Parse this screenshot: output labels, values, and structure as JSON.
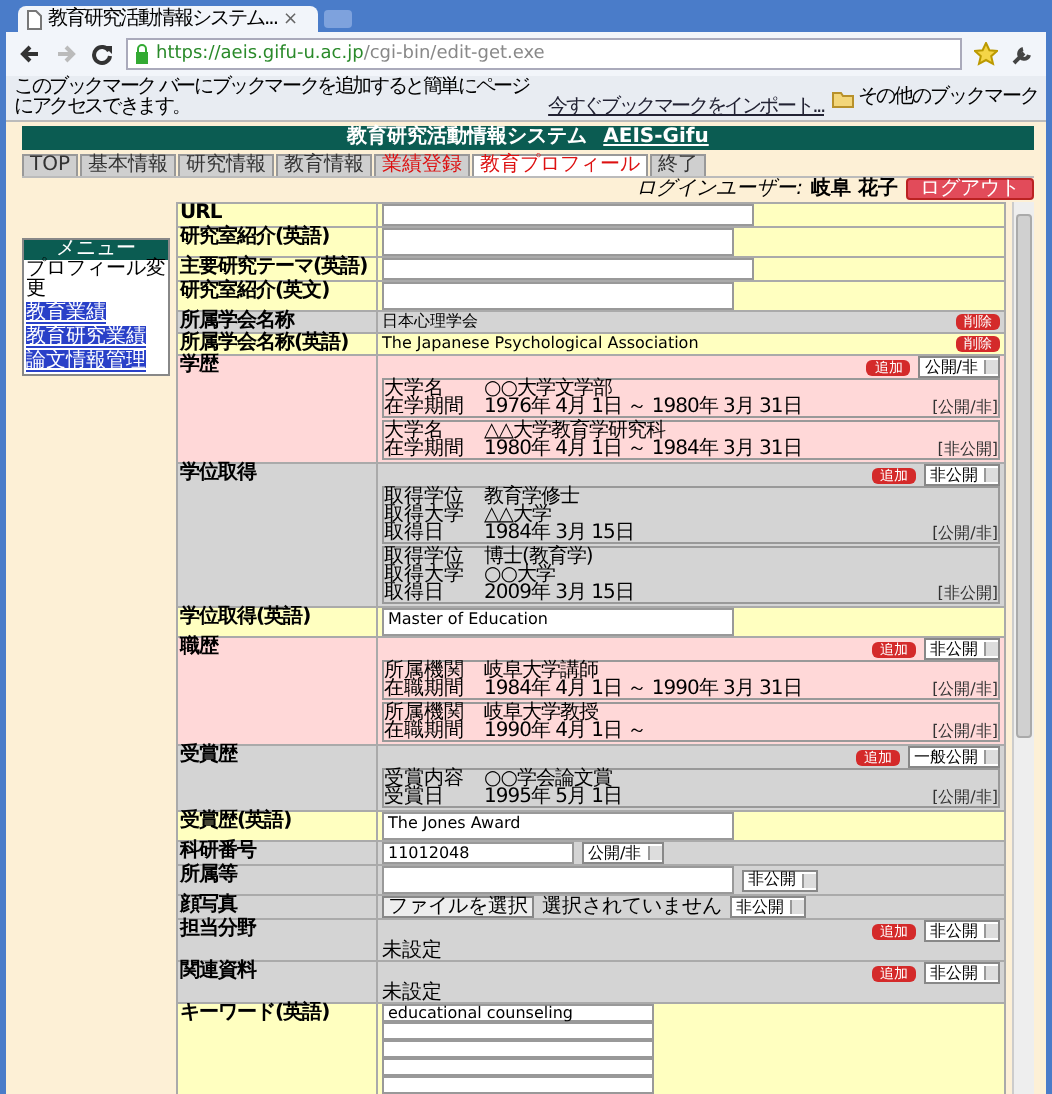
{
  "browser": {
    "tab_title": "教育研究活動情報システム...",
    "tab_close": "×",
    "url_host": "https://aeis.gifu-u.ac.jp",
    "url_path": "/cgi-bin/edit-get.exe",
    "bookmark_hint": "このブックマーク バーにブックマークを追加すると簡単にページにアクセスできます。",
    "bookmark_import": "今すぐブックマークをインポート...",
    "other_bookmarks": "その他のブックマーク"
  },
  "header": {
    "title": "教育研究活動情報システム",
    "link": "AEIS-Gifu"
  },
  "tabs": [
    {
      "label": "TOP",
      "selected": false,
      "emphasized": false
    },
    {
      "label": "基本情報",
      "selected": false,
      "emphasized": false
    },
    {
      "label": "研究情報",
      "selected": false,
      "emphasized": false
    },
    {
      "label": "教育情報",
      "selected": false,
      "emphasized": false
    },
    {
      "label": "業績登録",
      "selected": false,
      "emphasized": true
    },
    {
      "label": "教育プロフィール",
      "selected": true,
      "emphasized": true
    },
    {
      "label": "終了",
      "selected": false,
      "emphasized": false
    }
  ],
  "login": {
    "label": "ログインユーザー:",
    "user": "岐阜 花子",
    "logout": "ログアウト"
  },
  "sidebar": {
    "title": "メニュー",
    "items": [
      {
        "label": "プロフィール変更",
        "kind": "text"
      },
      {
        "label": "教育業績",
        "kind": "link"
      },
      {
        "label": "教育研究業績",
        "kind": "link"
      },
      {
        "label": "論文情報管理",
        "kind": "link"
      }
    ]
  },
  "rows": [
    {
      "kind": "input",
      "label": "URL",
      "color": "#ffffc0"
    },
    {
      "kind": "textarea",
      "label": "研究室紹介(英語)",
      "color": "#ffffc0"
    },
    {
      "kind": "input",
      "label": "主要研究テーマ(英語)",
      "color": "#ffffc0"
    },
    {
      "kind": "textarea",
      "label": "研究室紹介(英文)",
      "color": "#ffffc0"
    },
    {
      "kind": "text",
      "label": "所属学会名称",
      "color": "#d4d4d4",
      "value": "日本心理学会",
      "button": "削除"
    },
    {
      "kind": "text",
      "label": "所属学会名称(英語)",
      "color": "#ffffc0",
      "value": "The Japanese Psychological Association",
      "button": "削除"
    },
    {
      "kind": "list",
      "label": "学歴",
      "color": "#ffd8d8",
      "button": "追加",
      "visibility": "公開/非",
      "entries": [
        {
          "fields": [
            {
              "label": "大学名",
              "value": "○○大学文学部"
            },
            {
              "label": "在学期間",
              "value": "1976年 4月 1日 ～ 1980年 3月 31日"
            }
          ],
          "visibility": "[公開/非]"
        },
        {
          "fields": [
            {
              "label": "大学名",
              "value": "△△大学教育学研究科"
            },
            {
              "label": "在学期間",
              "value": "1980年 4月 1日 ～ 1984年 3月 31日"
            }
          ],
          "visibility": "[非公開]"
        }
      ]
    },
    {
      "kind": "list",
      "label": "学位取得",
      "color": "#d4d4d4",
      "button": "追加",
      "visibility": "非公開",
      "entries": [
        {
          "fields": [
            {
              "label": "取得学位",
              "value": "教育学修士"
            },
            {
              "label": "取得大学",
              "value": "△△大学"
            },
            {
              "label": "取得日",
              "value": "1984年 3月 15日"
            }
          ],
          "visibility": "[公開/非]"
        },
        {
          "fields": [
            {
              "label": "取得学位",
              "value": "博士(教育学)"
            },
            {
              "label": "取得大学",
              "value": "○○大学"
            },
            {
              "label": "取得日",
              "value": "2009年 3月 15日"
            }
          ],
          "visibility": "[非公開]"
        }
      ]
    },
    {
      "kind": "textarea",
      "label": "学位取得(英語)",
      "color": "#ffffc0",
      "value": "Master of Education"
    },
    {
      "kind": "list",
      "label": "職歴",
      "color": "#ffd8d8",
      "button": "追加",
      "visibility": "非公開",
      "entries": [
        {
          "fields": [
            {
              "label": "所属機関",
              "value": "岐阜大学講師"
            },
            {
              "label": "在職期間",
              "value": "1984年 4月 1日 ～ 1990年 3月 31日"
            }
          ],
          "visibility": "[公開/非]"
        },
        {
          "fields": [
            {
              "label": "所属機関",
              "value": "岐阜大学教授"
            },
            {
              "label": "在職期間",
              "value": "1990年 4月 1日 ～"
            }
          ],
          "visibility": "[公開/非]"
        }
      ]
    },
    {
      "kind": "list",
      "label": "受賞歴",
      "color": "#d4d4d4",
      "button": "追加",
      "visibility": "一般公開",
      "entries": [
        {
          "fields": [
            {
              "label": "受賞内容",
              "value": "○○学会論文賞"
            },
            {
              "label": "受賞日",
              "value": "1995年 5月 1日"
            }
          ],
          "visibility": "[公開/非]"
        }
      ]
    },
    {
      "kind": "textarea",
      "label": "受賞歴(英語)",
      "color": "#ffffc0",
      "value": "The Jones Award"
    },
    {
      "kind": "input",
      "label": "科研番号",
      "color": "#d4d4d4",
      "value": "11012048",
      "visibility": "公開/非"
    },
    {
      "kind": "textarea",
      "label": "所属等",
      "color": "#d4d4d4",
      "visibility": "非公開"
    },
    {
      "kind": "file",
      "label": "顔写真",
      "color": "#d4d4d4",
      "button": "ファイルを選択",
      "value": "選択されていません",
      "visibility": "非公開"
    },
    {
      "kind": "list",
      "label": "担当分野",
      "color": "#d4d4d4",
      "button": "追加",
      "visibility": "非公開",
      "note": "未設定"
    },
    {
      "kind": "list",
      "label": "関連資料",
      "color": "#d4d4d4",
      "button": "追加",
      "visibility": "非公開",
      "note": "未設定"
    },
    {
      "kind": "inputs",
      "label": "キーワード(英語)",
      "color": "#ffffc0",
      "fields": [
        {
          "kind": "input",
          "value": "educational counseling"
        },
        {
          "kind": "input"
        },
        {
          "kind": "input"
        },
        {
          "kind": "input"
        },
        {
          "kind": "input"
        }
      ]
    }
  ]
}
